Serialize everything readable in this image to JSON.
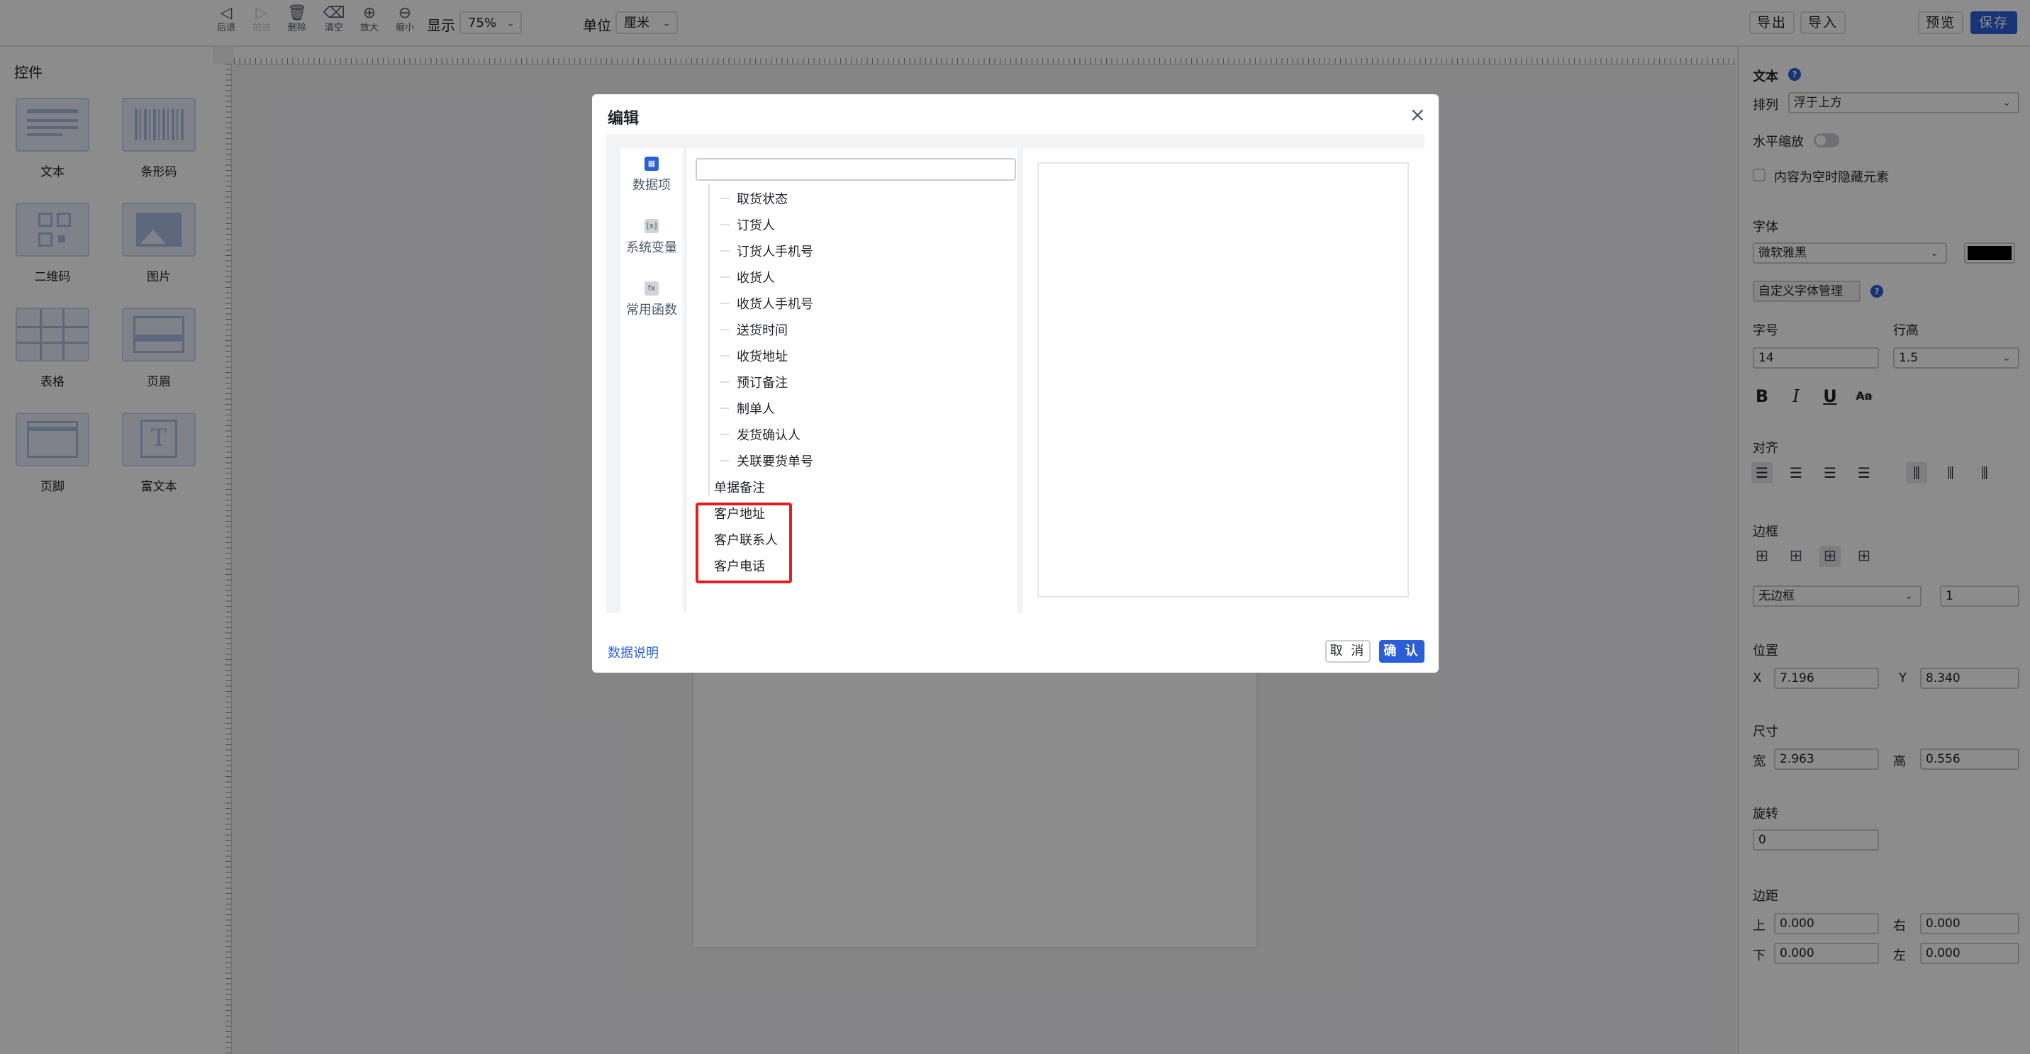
{
  "toolbar": {
    "tools": [
      {
        "icon": "back-icon",
        "glyph": "◁",
        "label": "后退",
        "enabled": true
      },
      {
        "icon": "forward-icon",
        "glyph": "▷",
        "label": "前进",
        "enabled": false
      },
      {
        "icon": "delete-icon",
        "glyph": "🗑",
        "label": "删除",
        "enabled": true
      },
      {
        "icon": "clear-icon",
        "glyph": "⌫",
        "label": "清空",
        "enabled": true
      },
      {
        "icon": "zoom-in-icon",
        "glyph": "⊕",
        "label": "放大",
        "enabled": true
      },
      {
        "icon": "zoom-out-icon",
        "glyph": "⊖",
        "label": "缩小",
        "enabled": true
      }
    ],
    "display_label": "显示",
    "display_value": "75%",
    "unit_label": "单位",
    "unit_value": "厘米",
    "export_label": "导出",
    "import_label": "导入",
    "preview_label": "预览",
    "save_label": "保存"
  },
  "left_panel": {
    "title": "控件",
    "widgets": [
      {
        "label": "文本",
        "icon": "text-widget-icon"
      },
      {
        "label": "条形码",
        "icon": "barcode-widget-icon"
      },
      {
        "label": "二维码",
        "icon": "qrcode-widget-icon"
      },
      {
        "label": "图片",
        "icon": "image-widget-icon"
      },
      {
        "label": "表格",
        "icon": "table-widget-icon"
      },
      {
        "label": "页眉",
        "icon": "header-widget-icon"
      },
      {
        "label": "页脚",
        "icon": "footer-widget-icon"
      },
      {
        "label": "富文本",
        "icon": "richtext-widget-icon"
      }
    ]
  },
  "right_panel": {
    "section_title": "文本",
    "arrange_label": "排列",
    "arrange_value": "浮于上方",
    "hscale_label": "水平缩放",
    "hide_empty_label": "内容为空时隐藏元素",
    "font_title": "字体",
    "font_value": "微软雅黑",
    "font_color": "#000000",
    "custom_font_label": "自定义字体管理",
    "size_label": "字号",
    "size_value": "14",
    "line_height_label": "行高",
    "line_height_value": "1.5",
    "style_buttons": [
      "B",
      "I",
      "U",
      "Aa"
    ],
    "align_title": "对齐",
    "border_title": "边框",
    "border_value": "无边框",
    "border_width": "1",
    "position_title": "位置",
    "x_label": "X",
    "x_value": "7.196",
    "y_label": "Y",
    "y_value": "8.340",
    "size_title": "尺寸",
    "width_label": "宽",
    "width_value": "2.963",
    "height_label": "高",
    "height_value": "0.556",
    "rotate_title": "旋转",
    "rotate_value": "0",
    "margin_title": "边距",
    "top_label": "上",
    "top_value": "0.000",
    "right_label": "右",
    "right_value": "0.000",
    "bottom_label": "下",
    "bottom_value": "0.000",
    "left_label": "左",
    "left_value": "0.000"
  },
  "modal": {
    "title": "编辑",
    "tabs": [
      {
        "label": "数据项",
        "icon": "data-item-icon",
        "active": true
      },
      {
        "label": "系统变量",
        "icon": "system-variable-icon",
        "active": false
      },
      {
        "label": "常用函数",
        "icon": "function-icon",
        "active": false
      }
    ],
    "search_value": "",
    "tree_child_items": [
      "取货状态",
      "订货人",
      "订货人手机号",
      "收货人",
      "收货人手机号",
      "送货时间",
      "收货地址",
      "预订备注",
      "制单人",
      "发货确认人",
      "关联要货单号"
    ],
    "tree_root_items": [
      "单据备注",
      "客户地址",
      "客户联系人",
      "客户电话"
    ],
    "footer_link": "数据说明",
    "cancel_label": "取 消",
    "confirm_label": "确 认",
    "highlight_color": "#e02020",
    "accent_color": "#2b5fd9"
  }
}
